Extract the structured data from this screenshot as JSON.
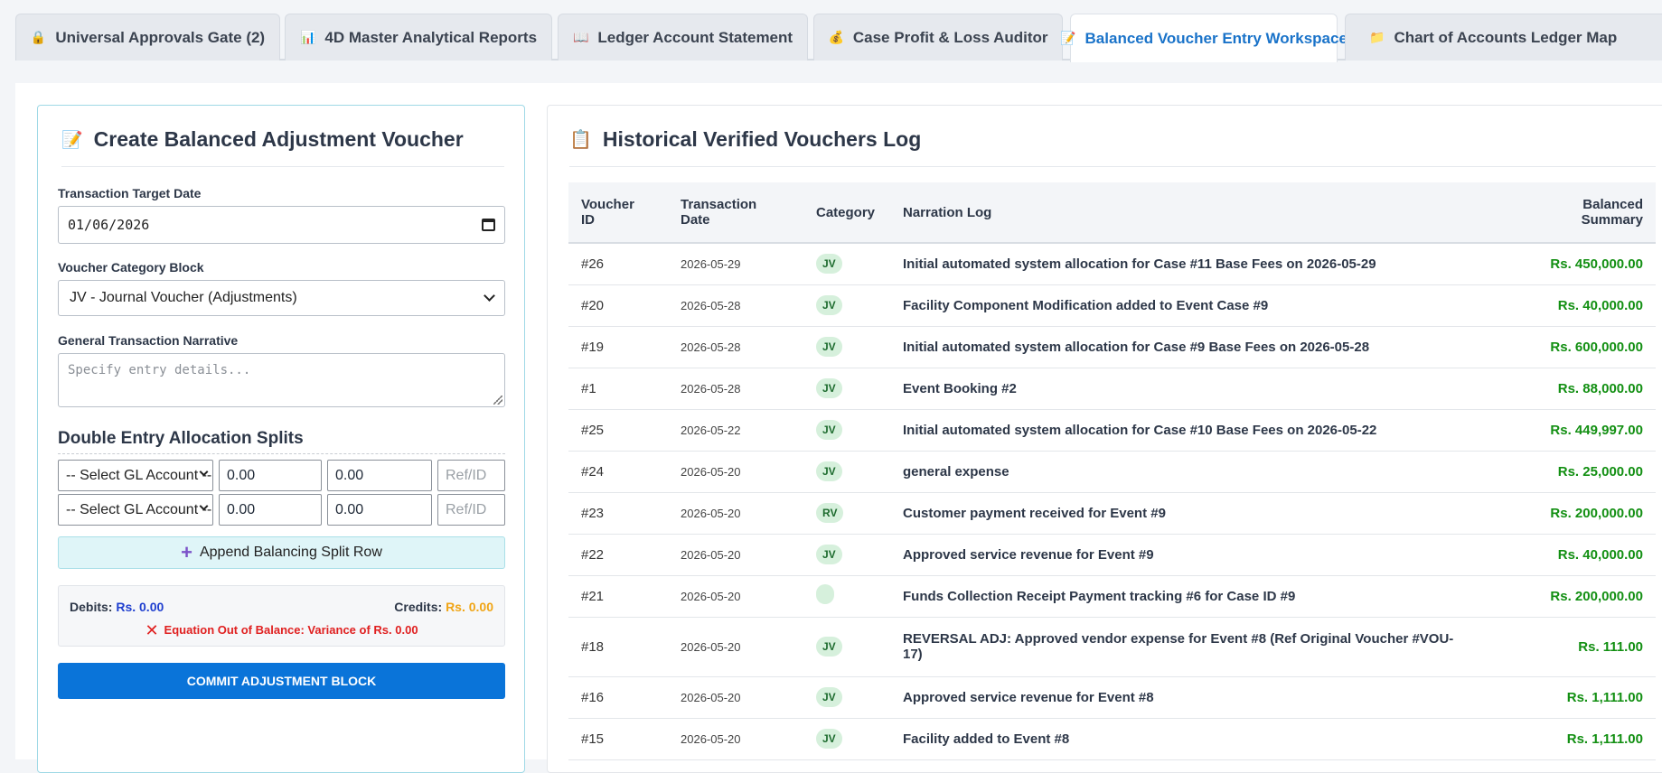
{
  "tabs": [
    {
      "icon": "lock-icon",
      "label": "Universal Approvals Gate (2)",
      "active": false
    },
    {
      "icon": "bar-chart-icon",
      "label": "4D Master Analytical Reports",
      "active": false
    },
    {
      "icon": "book-icon",
      "label": "Ledger Account Statement",
      "active": false
    },
    {
      "icon": "money-bag-icon",
      "label": "Case Profit & Loss Auditor",
      "active": false
    },
    {
      "icon": "memo-icon",
      "label": "Balanced Voucher Entry Workspace",
      "active": true
    },
    {
      "icon": "folder-icon",
      "label": "Chart of Accounts Ledger Map",
      "active": false
    }
  ],
  "form": {
    "title": "Create Balanced Adjustment Voucher",
    "date_label": "Transaction Target Date",
    "date_value": "01/06/2026",
    "category_label": "Voucher Category Block",
    "category_value": "JV - Journal Voucher (Adjustments)",
    "narrative_label": "General Transaction Narrative",
    "narrative_placeholder": "Specify entry details...",
    "splits_title": "Double Entry Allocation Splits",
    "split_rows": [
      {
        "account": "-- Select GL Account --",
        "debit": "0.00",
        "credit": "0.00",
        "ref_placeholder": "Ref/ID"
      },
      {
        "account": "-- Select GL Account --",
        "debit": "0.00",
        "credit": "0.00",
        "ref_placeholder": "Ref/ID"
      }
    ],
    "append_label": "Append Balancing Split Row",
    "debits_label": "Debits:",
    "debits_value": "Rs. 0.00",
    "credits_label": "Credits:",
    "credits_value": "Rs. 0.00",
    "balance_status": "Equation Out of Balance: Variance of Rs. 0.00",
    "commit_label": "COMMIT ADJUSTMENT BLOCK"
  },
  "log": {
    "title": "Historical Verified Vouchers Log",
    "headers": {
      "id_l1": "Voucher",
      "id_l2": "ID",
      "date_l1": "Transaction",
      "date_l2": "Date",
      "category": "Category",
      "narration": "Narration Log",
      "amount_l1": "Balanced",
      "amount_l2": "Summary"
    },
    "rows": [
      {
        "id": "#26",
        "date": "2026-05-29",
        "category": "JV",
        "narration": "Initial automated system allocation for Case #11 Base Fees on 2026-05-29",
        "amount": "Rs. 450,000.00"
      },
      {
        "id": "#20",
        "date": "2026-05-28",
        "category": "JV",
        "narration": "Facility Component Modification added to Event Case #9",
        "amount": "Rs. 40,000.00"
      },
      {
        "id": "#19",
        "date": "2026-05-28",
        "category": "JV",
        "narration": "Initial automated system allocation for Case #9 Base Fees on 2026-05-28",
        "amount": "Rs. 600,000.00"
      },
      {
        "id": "#1",
        "date": "2026-05-28",
        "category": "JV",
        "narration": "Event Booking #2",
        "amount": "Rs. 88,000.00"
      },
      {
        "id": "#25",
        "date": "2026-05-22",
        "category": "JV",
        "narration": "Initial automated system allocation for Case #10 Base Fees on 2026-05-22",
        "amount": "Rs. 449,997.00"
      },
      {
        "id": "#24",
        "date": "2026-05-20",
        "category": "JV",
        "narration": "general expense",
        "amount": "Rs. 25,000.00"
      },
      {
        "id": "#23",
        "date": "2026-05-20",
        "category": "RV",
        "narration": "Customer payment received for Event #9",
        "amount": "Rs. 200,000.00"
      },
      {
        "id": "#22",
        "date": "2026-05-20",
        "category": "JV",
        "narration": "Approved service revenue for Event #9",
        "amount": "Rs. 40,000.00"
      },
      {
        "id": "#21",
        "date": "2026-05-20",
        "category": "",
        "narration": "Funds Collection Receipt Payment tracking #6 for Case ID #9",
        "amount": "Rs. 200,000.00"
      },
      {
        "id": "#18",
        "date": "2026-05-20",
        "category": "JV",
        "narration": "REVERSAL ADJ: Approved vendor expense for Event #8 (Ref Original Voucher #VOU-17)",
        "amount": "Rs. 111.00"
      },
      {
        "id": "#16",
        "date": "2026-05-20",
        "category": "JV",
        "narration": "Approved service revenue for Event #8",
        "amount": "Rs. 1,111.00"
      },
      {
        "id": "#15",
        "date": "2026-05-20",
        "category": "JV",
        "narration": "Facility added to Event #8",
        "amount": "Rs. 1,111.00"
      }
    ]
  },
  "colors": {
    "accent": "#0a74d9",
    "amount_green": "#128f12",
    "error_red": "#e02020",
    "debit_blue": "#1f3fcf",
    "credit_orange": "#f0a516"
  }
}
